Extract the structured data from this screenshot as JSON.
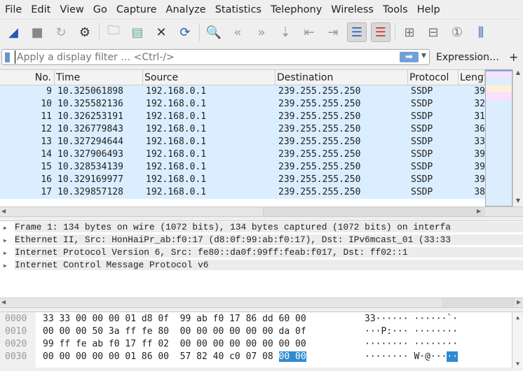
{
  "menu": [
    "File",
    "Edit",
    "View",
    "Go",
    "Capture",
    "Analyze",
    "Statistics",
    "Telephony",
    "Wireless",
    "Tools",
    "Help"
  ],
  "toolbar": [
    "shark-fin-start-icon",
    "stop-icon",
    "restart-icon",
    "options-gear-icon",
    "open-folder-icon",
    "file-icon",
    "close-file-icon",
    "reload-icon",
    "search-icon",
    "go-back-icon",
    "go-forward-icon",
    "go-to-packet-icon",
    "first-packet-icon",
    "last-packet-icon",
    "autoscroll-icon",
    "colorize-icon",
    "zoom-in-icon",
    "zoom-out-icon",
    "normal-size-icon",
    "resize-columns-icon"
  ],
  "filter": {
    "placeholder": "Apply a display filter … <Ctrl-/>",
    "expression": "Expression…",
    "plus": "+"
  },
  "columns": [
    "No.",
    "Time",
    "Source",
    "Destination",
    "Protocol",
    "Length"
  ],
  "packets": [
    [
      "9",
      "10.325061898",
      "192.168.0.1",
      "239.255.255.250",
      "SSDP",
      "39"
    ],
    [
      "10",
      "10.325582136",
      "192.168.0.1",
      "239.255.255.250",
      "SSDP",
      "32"
    ],
    [
      "11",
      "10.326253191",
      "192.168.0.1",
      "239.255.255.250",
      "SSDP",
      "31"
    ],
    [
      "12",
      "10.326779843",
      "192.168.0.1",
      "239.255.255.250",
      "SSDP",
      "36"
    ],
    [
      "13",
      "10.327294644",
      "192.168.0.1",
      "239.255.255.250",
      "SSDP",
      "33"
    ],
    [
      "14",
      "10.327906493",
      "192.168.0.1",
      "239.255.255.250",
      "SSDP",
      "39"
    ],
    [
      "15",
      "10.328534139",
      "192.168.0.1",
      "239.255.255.250",
      "SSDP",
      "39"
    ],
    [
      "16",
      "10.329169977",
      "192.168.0.1",
      "239.255.255.250",
      "SSDP",
      "39"
    ],
    [
      "17",
      "10.329857128",
      "192.168.0.1",
      "239.255.255.250",
      "SSDP",
      "38"
    ]
  ],
  "details": [
    "Frame 1: 134 bytes on wire (1072 bits), 134 bytes captured (1072 bits) on interfa",
    "Ethernet II, Src: HonHaiPr_ab:f0:17 (d8:0f:99:ab:f0:17), Dst: IPv6mcast_01 (33:33",
    "Internet Protocol Version 6, Src: fe80::da0f:99ff:feab:f017, Dst: ff02::1",
    "Internet Control Message Protocol v6"
  ],
  "hex": [
    {
      "off": "0000",
      "hex": "33 33 00 00 00 01 d8 0f  99 ab f0 17 86 dd 60 00",
      "sel": "",
      "ascii": "33······ ······`·",
      "asel": ""
    },
    {
      "off": "0010",
      "hex": "00 00 00 50 3a ff fe 80  00 00 00 00 00 00 da 0f",
      "sel": "",
      "ascii": "···P:··· ········",
      "asel": ""
    },
    {
      "off": "0020",
      "hex": "99 ff fe ab f0 17 ff 02  00 00 00 00 00 00 00 00",
      "sel": "",
      "ascii": "········ ········",
      "asel": ""
    },
    {
      "off": "0030",
      "hex": "00 00 00 00 00 01 86 00  57 82 40 c0 07 08 ",
      "sel": "00 00",
      "ascii": "········ W·@···",
      "asel": "··"
    }
  ],
  "colors": {
    "row_bg": "#daeeff",
    "selection": "#2f8bd0"
  }
}
